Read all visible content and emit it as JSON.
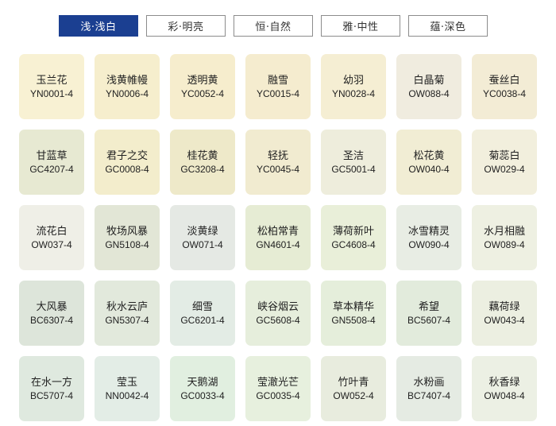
{
  "tabs": [
    {
      "label": "浅·浅白",
      "active": true
    },
    {
      "label": "彩·明亮",
      "active": false
    },
    {
      "label": "恒·自然",
      "active": false
    },
    {
      "label": "雅·中性",
      "active": false
    },
    {
      "label": "蕴·深色",
      "active": false
    }
  ],
  "swatches": [
    {
      "name": "玉兰花",
      "code": "YN0001-4",
      "color": "#f8f1d3"
    },
    {
      "name": "浅黄帷幔",
      "code": "YN0006-4",
      "color": "#f6eecd"
    },
    {
      "name": "透明黄",
      "code": "YC0052-4",
      "color": "#f6edcd"
    },
    {
      "name": "融雪",
      "code": "YC0015-4",
      "color": "#f5eccf"
    },
    {
      "name": "幼羽",
      "code": "YN0028-4",
      "color": "#f5eed3"
    },
    {
      "name": "白晶菊",
      "code": "OW088-4",
      "color": "#f0ecdf"
    },
    {
      "name": "蚕丝白",
      "code": "YC0038-4",
      "color": "#f3ecd5"
    },
    {
      "name": "甘蓝草",
      "code": "GC4207-4",
      "color": "#e7e9d2"
    },
    {
      "name": "君子之交",
      "code": "GC0008-4",
      "color": "#f3edcc"
    },
    {
      "name": "桂花黄",
      "code": "GC3208-4",
      "color": "#eee9c9"
    },
    {
      "name": "轻抚",
      "code": "YC0045-4",
      "color": "#f1ebd0"
    },
    {
      "name": "圣洁",
      "code": "GC5001-4",
      "color": "#eeeddc"
    },
    {
      "name": "松花黄",
      "code": "OW040-4",
      "color": "#f1edd4"
    },
    {
      "name": "菊蕊白",
      "code": "OW029-4",
      "color": "#f2efdd"
    },
    {
      "name": "流花白",
      "code": "OW037-4",
      "color": "#efefe7"
    },
    {
      "name": "牧场风暴",
      "code": "GN5108-4",
      "color": "#e2e6d6"
    },
    {
      "name": "淡黄绿",
      "code": "OW071-4",
      "color": "#e5e9e4"
    },
    {
      "name": "松柏常青",
      "code": "GN4601-4",
      "color": "#e6ecd4"
    },
    {
      "name": "薄荷新叶",
      "code": "GC4608-4",
      "color": "#e9efd9"
    },
    {
      "name": "冰雪精灵",
      "code": "OW090-4",
      "color": "#e8ede4"
    },
    {
      "name": "水月相融",
      "code": "OW089-4",
      "color": "#eef0e2"
    },
    {
      "name": "大风暴",
      "code": "BC6307-4",
      "color": "#dde5da"
    },
    {
      "name": "秋水云庐",
      "code": "GN5307-4",
      "color": "#e2e9dc"
    },
    {
      "name": "细雪",
      "code": "GC6201-4",
      "color": "#e3ece5"
    },
    {
      "name": "峡谷烟云",
      "code": "GC5608-4",
      "color": "#e6eedc"
    },
    {
      "name": "草本精华",
      "code": "GN5508-4",
      "color": "#e5eedb"
    },
    {
      "name": "希望",
      "code": "BC5607-4",
      "color": "#e2ebdc"
    },
    {
      "name": "藕荷绿",
      "code": "OW043-4",
      "color": "#ecefe1"
    },
    {
      "name": "在水一方",
      "code": "BC5707-4",
      "color": "#dfe9df"
    },
    {
      "name": "莹玉",
      "code": "NN0042-4",
      "color": "#e3ede6"
    },
    {
      "name": "天鹅湖",
      "code": "GC0033-4",
      "color": "#e1efe0"
    },
    {
      "name": "莹澈光芒",
      "code": "GC0035-4",
      "color": "#e7f0de"
    },
    {
      "name": "竹叶青",
      "code": "OW052-4",
      "color": "#e8ecde"
    },
    {
      "name": "水粉画",
      "code": "BC7407-4",
      "color": "#e5ebe3"
    },
    {
      "name": "秋香绿",
      "code": "OW048-4",
      "color": "#ecf0e4"
    }
  ]
}
